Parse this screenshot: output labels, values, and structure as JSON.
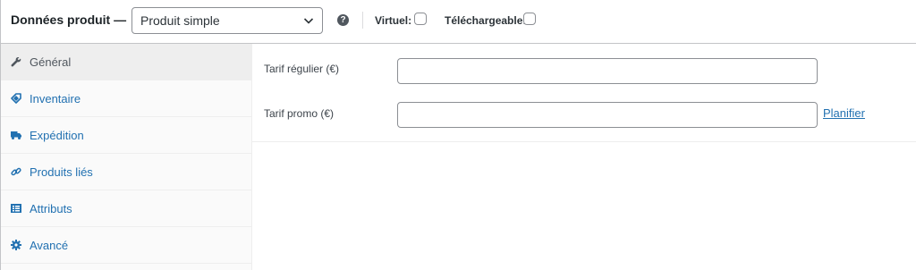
{
  "header": {
    "title": "Données produit —",
    "product_type": {
      "selected": "Produit simple",
      "icon": "chevron-down-icon"
    },
    "help_icon": "question-icon",
    "help_glyph": "?",
    "virtual_label": "Virtuel:",
    "virtual_checked": false,
    "downloadable_label": "Téléchargeable:",
    "downloadable_checked": false
  },
  "sidebar": {
    "items": [
      {
        "label": "Général",
        "icon": "wrench-icon",
        "active": true
      },
      {
        "label": "Inventaire",
        "icon": "tag-icon",
        "active": false
      },
      {
        "label": "Expédition",
        "icon": "truck-icon",
        "active": false
      },
      {
        "label": "Produits liés",
        "icon": "link-icon",
        "active": false
      },
      {
        "label": "Attributs",
        "icon": "list-icon",
        "active": false
      },
      {
        "label": "Avancé",
        "icon": "gear-icon",
        "active": false
      }
    ]
  },
  "main": {
    "regular_price": {
      "label": "Tarif régulier (€)",
      "value": ""
    },
    "sale_price": {
      "label": "Tarif promo (€)",
      "value": ""
    },
    "schedule_link": "Planifier"
  },
  "colors": {
    "link": "#2271b1",
    "active_tab_bg": "#eeeeee",
    "sidebar_bg": "#fafafa",
    "border": "#c3c4c7"
  }
}
